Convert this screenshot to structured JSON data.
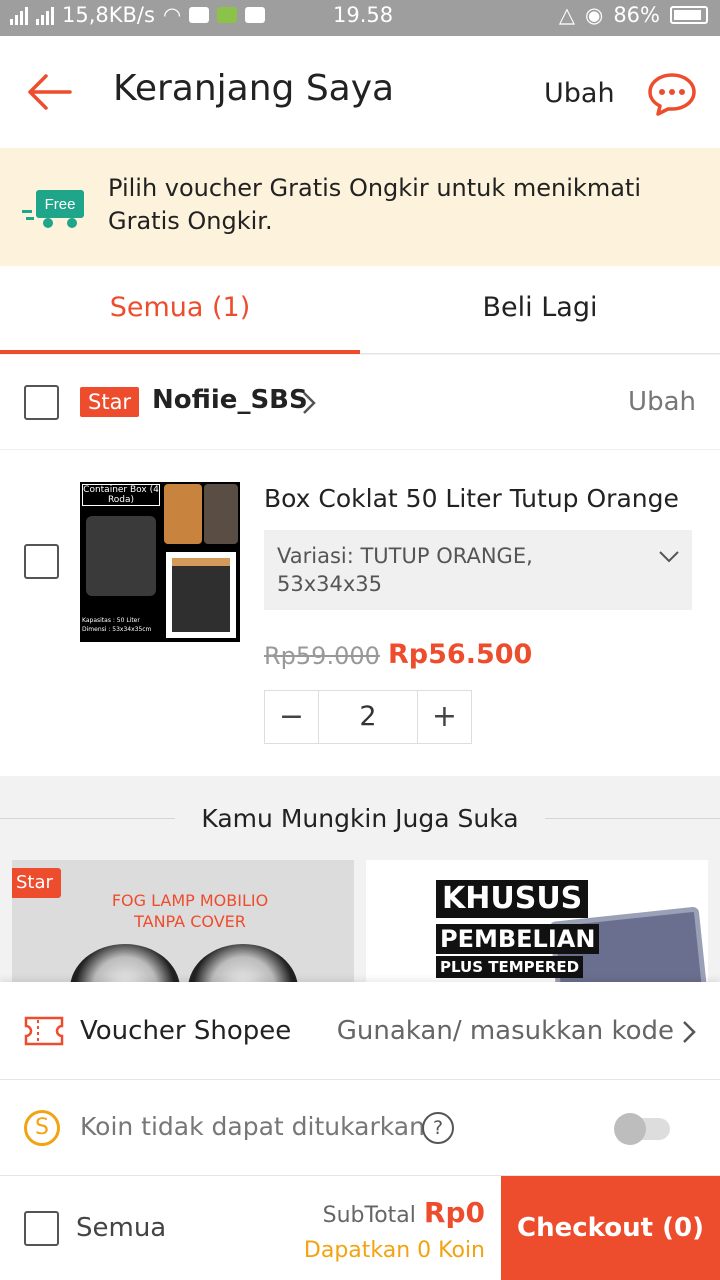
{
  "status_bar": {
    "speed": "15,8KB/s",
    "time": "19.58",
    "battery": "86%"
  },
  "header": {
    "title": "Keranjang Saya",
    "edit_label": "Ubah"
  },
  "banner": {
    "text": "Pilih voucher Gratis Ongkir untuk menikmati Gratis Ongkir.",
    "truck_label": "Free"
  },
  "tabs": [
    {
      "label": "Semua (1)"
    },
    {
      "label": "Beli Lagi"
    }
  ],
  "shop": {
    "badge": "Star",
    "name": "Nofiie_SBS",
    "edit_label": "Ubah"
  },
  "product": {
    "name": "Box Coklat 50 Liter Tutup Orange",
    "variant": "Variasi: TUTUP ORANGE, 53x34x35",
    "price_original": "Rp59.000",
    "price_discount": "Rp56.500",
    "quantity": "2",
    "minus_label": "−",
    "plus_label": "+",
    "image_text": {
      "title": "Container Box (4 Roda)",
      "spec": "Kapasitas : 50 Liter Dimensi : 53x34x35cm"
    }
  },
  "recommendations": {
    "title": "Kamu Mungkin Juga Suka",
    "cards": [
      {
        "badge": "Star",
        "text": "FOG LAMP MOBILIO TANPA COVER"
      },
      {
        "line1": "KHUSUS",
        "line2": "PEMBELIAN",
        "line3": "PLUS TEMPERED"
      }
    ]
  },
  "voucher": {
    "label": "Voucher Shopee",
    "value": "Gunakan/ masukkan kode"
  },
  "coins": {
    "label": "Koin tidak dapat ditukarkan",
    "help": "?",
    "coin_symbol": "S",
    "toggle_on": false
  },
  "footer": {
    "select_all": "Semua",
    "subtotal_label": "SubTotal",
    "subtotal_value": "Rp0",
    "coins_earn": "Dapatkan 0 Koin",
    "checkout": "Checkout (0)"
  },
  "colors": {
    "accent": "#ee4d2d",
    "coin": "#f2a311",
    "banner_bg": "#fdf3dc",
    "status_bar": "#9e9e9e"
  }
}
